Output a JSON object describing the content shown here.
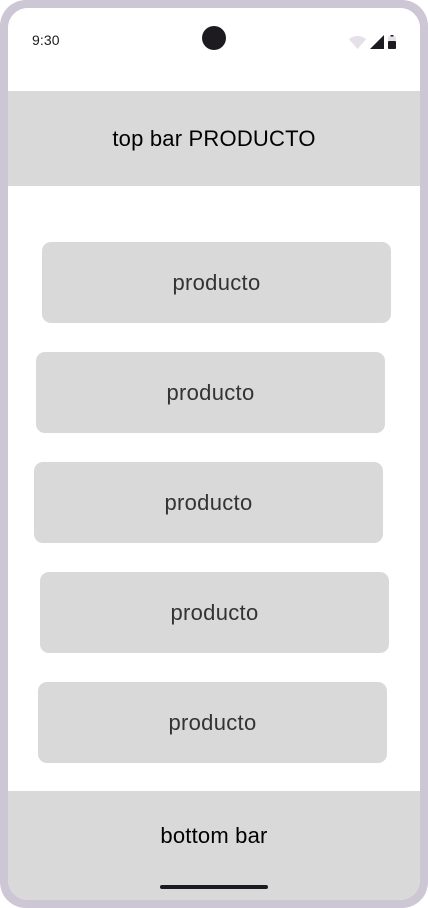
{
  "status_bar": {
    "time": "9:30",
    "icons": [
      "wifi-icon",
      "cellular-signal-icon",
      "battery-icon"
    ]
  },
  "top_bar": {
    "title": "top bar PRODUCTO"
  },
  "products": [
    {
      "label": "producto"
    },
    {
      "label": "producto"
    },
    {
      "label": "producto"
    },
    {
      "label": "producto"
    },
    {
      "label": "producto"
    }
  ],
  "bottom_bar": {
    "title": "bottom bar"
  },
  "colors": {
    "frame": "#cdc6d4",
    "surface": "#ffffff",
    "placeholder": "#d9d9d9",
    "text_dark": "#1d1b20"
  }
}
